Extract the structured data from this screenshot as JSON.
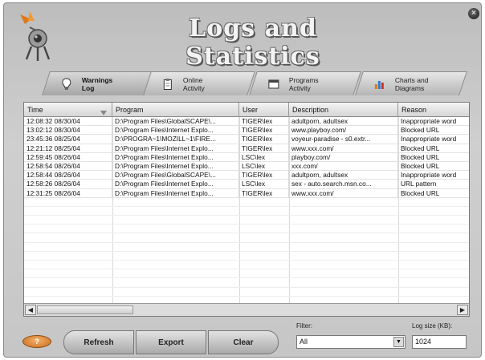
{
  "window": {
    "title": "Logs and Statistics",
    "close_icon": "close-icon"
  },
  "tabs": [
    {
      "label": "Warnings\nLog",
      "icon": "lightbulb-icon",
      "active": true
    },
    {
      "label": "Online\nActivity",
      "icon": "clipboard-icon",
      "active": false
    },
    {
      "label": "Programs\nActivity",
      "icon": "window-icon",
      "active": false
    },
    {
      "label": "Charts and\nDiagrams",
      "icon": "bar-chart-icon",
      "active": false
    }
  ],
  "table": {
    "columns": [
      "Time",
      "Program",
      "User",
      "Description",
      "Reason"
    ],
    "rows": [
      [
        "12:08:32 08/30/04",
        "D:\\Program Files\\GlobalSCAPE\\...",
        "TIGER\\lex",
        "adultporn, adultsex",
        "Inappropriate word"
      ],
      [
        "13:02:12 08/30/04",
        "D:\\Program Files\\Internet Explo...",
        "TIGER\\lex",
        "www.playboy.com/",
        "Blocked URL"
      ],
      [
        "23:45:36 08/25/04",
        "D:\\PROGRA~1\\MOZILL~1\\FIRE...",
        "TIGER\\lex",
        "voyeur-paradise - s0.extr...",
        "Inappropriate word"
      ],
      [
        "12:21:12 08/25/04",
        "D:\\Program Files\\Internet Explo...",
        "TIGER\\lex",
        "www.xxx.com/",
        "Blocked URL"
      ],
      [
        "12:59:45 08/26/04",
        "D:\\Program Files\\Internet Explo...",
        "LSC\\lex",
        "playboy.com/",
        "Blocked URL"
      ],
      [
        "12:58:54 08/26/04",
        "D:\\Program Files\\Internet Explo...",
        "LSC\\lex",
        "xxx.com/",
        "Blocked URL"
      ],
      [
        "12:58:44 08/26/04",
        "D:\\Program Files\\GlobalSCAPE\\...",
        "TIGER\\lex",
        "adultporn, adultsex",
        "Inappropriate word"
      ],
      [
        "12:58:26 08/26/04",
        "D:\\Program Files\\Internet Explo...",
        "LSC\\lex",
        "sex - auto.search.msn.co...",
        "URL pattern"
      ],
      [
        "12:31:25 08/26/04",
        "D:\\Program Files\\Internet Explo...",
        "TIGER\\lex",
        "www.xxx.com/",
        "Blocked URL"
      ]
    ],
    "empty_rows": 11
  },
  "buttons": {
    "help": "?",
    "refresh": "Refresh",
    "export": "Export",
    "clear": "Clear"
  },
  "filter": {
    "label": "Filter:",
    "value": "All"
  },
  "log_size": {
    "label": "Log size (KB):",
    "value": "1024"
  },
  "colors": {
    "window_bg": "#c6c6c6",
    "help_button": "#e08a3a"
  }
}
